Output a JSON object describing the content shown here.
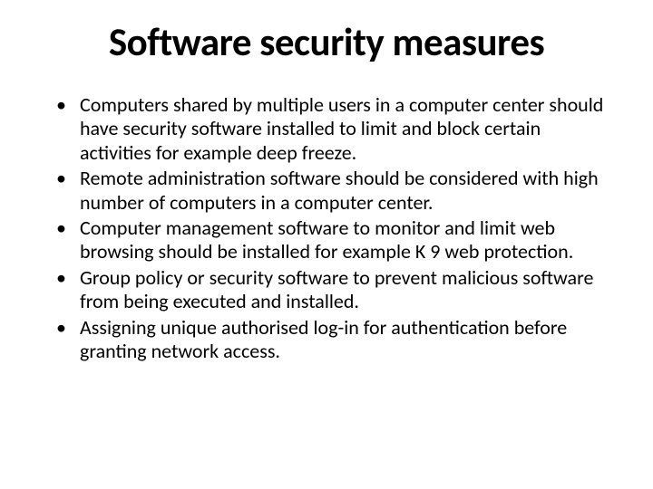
{
  "title": "Software security measures",
  "bullets": [
    " Computers shared by multiple users in a computer center should have security software installed to limit and block certain activities for example deep freeze.",
    "Remote administration software should be considered with high number of computers in a computer center.",
    "Computer management software to monitor and limit web browsing should be installed for example K 9 web protection.",
    "Group policy or security software to prevent malicious software from being executed and installed.",
    "Assigning unique authorised log-in for authentication before granting network access."
  ]
}
